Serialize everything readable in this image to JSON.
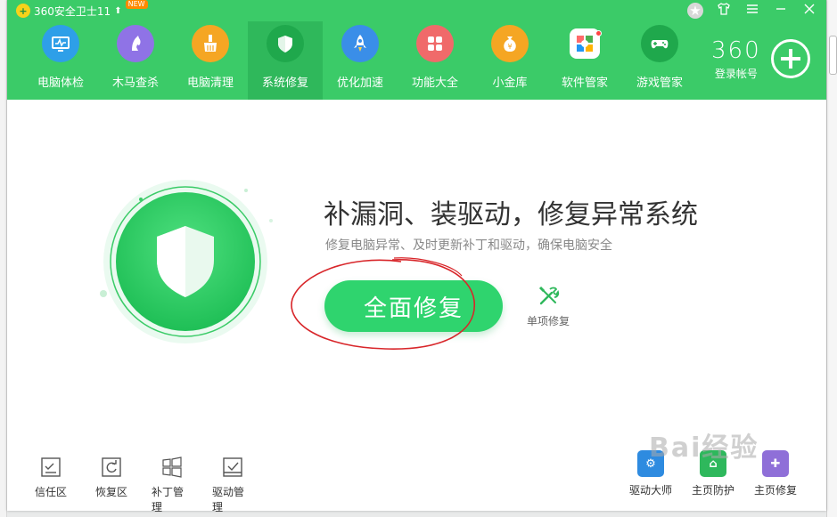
{
  "window": {
    "title": "360安全卫士11",
    "new_badge": "NEW",
    "controls": [
      "medal",
      "skin",
      "menu",
      "minimize",
      "close"
    ]
  },
  "nav": {
    "items": [
      {
        "label": "电脑体检",
        "icon": "monitor-icon",
        "color": "#2e9fe8"
      },
      {
        "label": "木马查杀",
        "icon": "horse-icon",
        "color": "#8f73e6"
      },
      {
        "label": "电脑清理",
        "icon": "broom-icon",
        "color": "#f5a623"
      },
      {
        "label": "系统修复",
        "icon": "shield-icon",
        "color": "#1fa84c",
        "active": true
      },
      {
        "label": "优化加速",
        "icon": "rocket-icon",
        "color": "#3a8ee8"
      },
      {
        "label": "功能大全",
        "icon": "grid-icon",
        "color": "#f06a6a"
      },
      {
        "label": "小金库",
        "icon": "money-bag-icon",
        "color": "#f5a623"
      },
      {
        "label": "软件管家",
        "icon": "apps-icon",
        "color": "#ffffff",
        "badge": true
      },
      {
        "label": "游戏管家",
        "icon": "gamepad-icon",
        "color": "#1fa84c"
      }
    ]
  },
  "account": {
    "brand": "360",
    "label": "登录帐号"
  },
  "main": {
    "headline": "补漏洞、装驱动，修复异常系统",
    "subline": "修复电脑异常、及时更新补丁和驱动，确保电脑安全",
    "repair_button": "全面修复",
    "single_repair": "单项修复"
  },
  "bottom_tools": [
    {
      "label": "信任区",
      "icon": "trust-zone-icon"
    },
    {
      "label": "恢复区",
      "icon": "restore-zone-icon"
    },
    {
      "label": "补丁管理",
      "icon": "patch-manage-icon"
    },
    {
      "label": "驱动管理",
      "icon": "driver-manage-icon"
    }
  ],
  "bottom_right": [
    {
      "label": "驱动大师",
      "icon": "driver-master-icon",
      "color": "#2e8be0"
    },
    {
      "label": "主页防护",
      "icon": "homepage-protect-icon",
      "color": "#2eb85c"
    },
    {
      "label": "主页修复",
      "icon": "homepage-repair-icon",
      "color": "#8f6fd8"
    }
  ],
  "colors": {
    "brand_green": "#3bcb68",
    "active_tab": "#2fb85b",
    "button_green": "#2fd46e"
  }
}
